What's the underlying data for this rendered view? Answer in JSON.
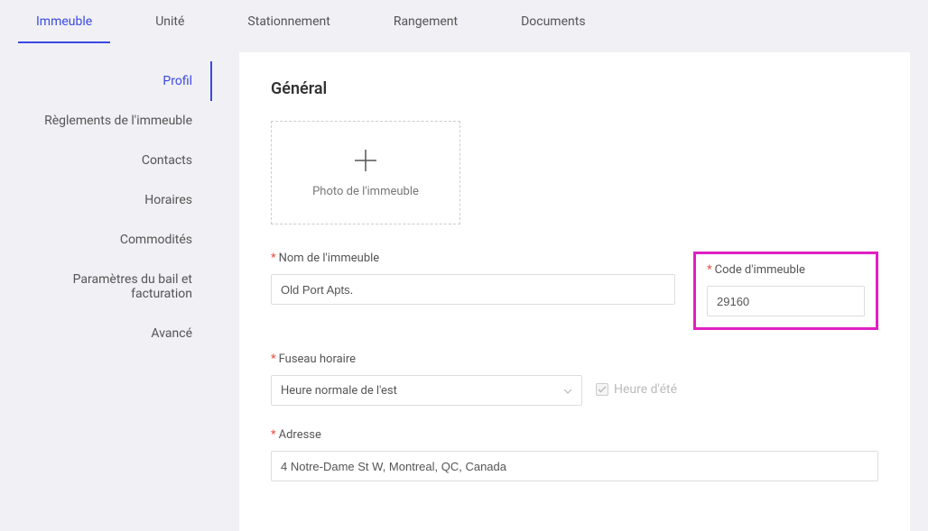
{
  "tabs": [
    {
      "label": "Immeuble",
      "active": true
    },
    {
      "label": "Unité",
      "active": false
    },
    {
      "label": "Stationnement",
      "active": false
    },
    {
      "label": "Rangement",
      "active": false
    },
    {
      "label": "Documents",
      "active": false
    }
  ],
  "sidebar": [
    {
      "label": "Profil",
      "active": true
    },
    {
      "label": "Règlements de l'immeuble",
      "active": false
    },
    {
      "label": "Contacts",
      "active": false
    },
    {
      "label": "Horaires",
      "active": false
    },
    {
      "label": "Commodités",
      "active": false
    },
    {
      "label": "Paramètres du bail et facturation",
      "active": false
    },
    {
      "label": "Avancé",
      "active": false
    }
  ],
  "general": {
    "title": "Général",
    "photo_label": "Photo de l'immeuble",
    "building_name": {
      "label": "Nom de l'immeuble",
      "value": "Old Port Apts."
    },
    "building_code": {
      "label": "Code d'immeuble",
      "value": "29160"
    },
    "timezone": {
      "label": "Fuseau horaire",
      "value": "Heure normale de l'est"
    },
    "dst": {
      "label": "Heure d'été",
      "checked": true
    },
    "address": {
      "label": "Adresse",
      "value": "4 Notre-Dame St W, Montreal, QC, Canada"
    }
  }
}
